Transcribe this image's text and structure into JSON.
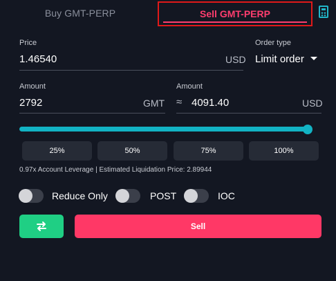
{
  "tabs": {
    "buy_label": "Buy GMT-PERP",
    "sell_label": "Sell GMT-PERP",
    "active": "sell"
  },
  "price": {
    "label": "Price",
    "value": "1.46540",
    "unit": "USD"
  },
  "order_type": {
    "label": "Order type",
    "value": "Limit order"
  },
  "amount": {
    "label": "Amount",
    "value": "2792",
    "unit": "GMT"
  },
  "amount_usd": {
    "label": "Amount",
    "approx_symbol": "≈",
    "value": "4091.40",
    "unit": "USD"
  },
  "slider": {
    "percent": 100
  },
  "percent_buttons": [
    "25%",
    "50%",
    "75%",
    "100%"
  ],
  "leverage_info": "0.97x Account Leverage | Estimated Liquidation Price: 2.89944",
  "toggles": [
    {
      "label": "Reduce Only",
      "on": false
    },
    {
      "label": "POST",
      "on": false
    },
    {
      "label": "IOC",
      "on": false
    }
  ],
  "actions": {
    "sell_label": "Sell"
  },
  "colors": {
    "accent": "#12b3c4",
    "sell": "#ff3866",
    "buy": "#1fcf84",
    "background": "#131722"
  },
  "icons": {
    "calculator": "calculator-icon",
    "swap": "swap-arrows-icon",
    "caret": "chevron-down-icon"
  }
}
